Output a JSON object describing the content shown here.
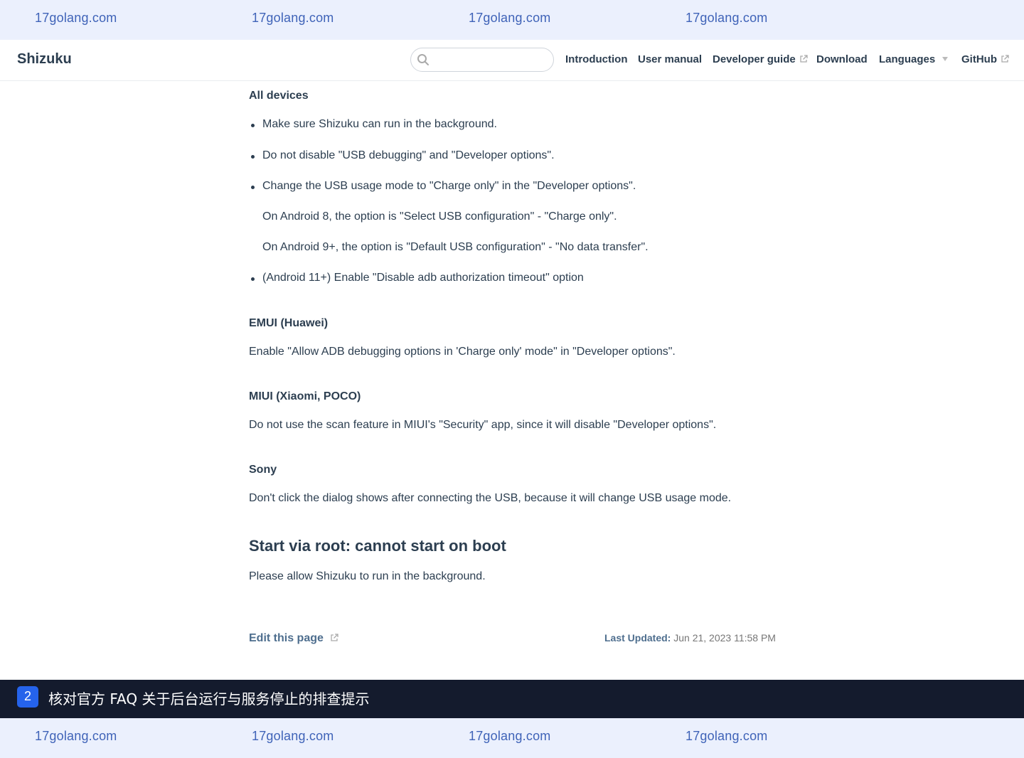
{
  "watermark": {
    "text": "17golang.com"
  },
  "navbar": {
    "site_name": "Shizuku",
    "search_placeholder": "",
    "links": [
      {
        "label": "Introduction"
      },
      {
        "label": "User manual"
      },
      {
        "label": "Developer guide"
      },
      {
        "label": "Download"
      },
      {
        "label": "Languages"
      },
      {
        "label": "GitHub"
      }
    ]
  },
  "content": {
    "all_devices": {
      "heading": "All devices",
      "items": [
        "Make sure Shizuku can run in the background.",
        "Do not disable \"USB debugging\" and \"Developer options\".",
        "Change the USB usage mode to \"Charge only\" in the \"Developer options\".",
        "(Android 11+) Enable \"Disable adb authorization timeout\" option"
      ],
      "sub_notes": [
        "On Android 8, the option is \"Select USB configuration\" - \"Charge only\".",
        "On Android 9+, the option is \"Default USB configuration\" - \"No data transfer\"."
      ]
    },
    "emui": {
      "heading": "EMUI (Huawei)",
      "text": "Enable \"Allow ADB debugging options in 'Charge only' mode\" in \"Developer options\"."
    },
    "miui": {
      "heading": "MIUI (Xiaomi, POCO)",
      "text": "Do not use the scan feature in MIUI's \"Security\" app, since it will disable \"Developer options\"."
    },
    "sony": {
      "heading": "Sony",
      "text": "Don't click the dialog shows after connecting the USB, because it will change USB usage mode."
    },
    "root_section": {
      "heading": "Start via root: cannot start on boot",
      "text": "Please allow Shizuku to run in the background."
    }
  },
  "footer": {
    "edit_link": "Edit this page",
    "last_updated_label": "Last Updated:",
    "last_updated_value": "Jun 21, 2023 11:58 PM"
  },
  "caption": {
    "step": "2",
    "text": "核对官方 FAQ 关于后台运行与服务停止的排查提示"
  },
  "colors": {
    "watermark_band": "#ebf0fd",
    "watermark_text": "#3f63b8",
    "caption_bg": "#141b2d",
    "badge": "#2563eb",
    "link": "#4e6e8e"
  }
}
